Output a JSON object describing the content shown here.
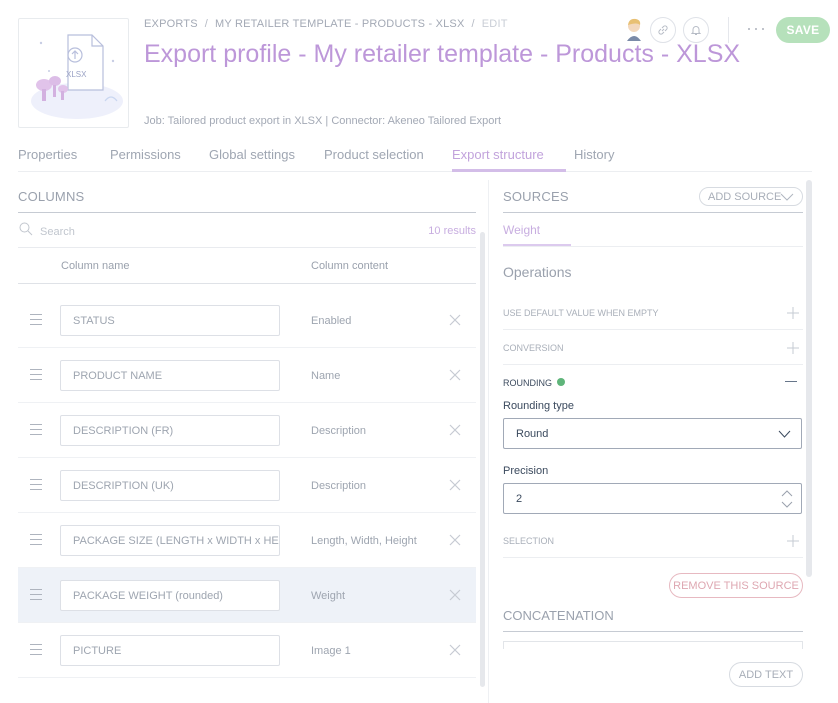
{
  "header": {
    "breadcrumb": [
      "EXPORTS",
      "MY RETAILER TEMPLATE - PRODUCTS - XLSX",
      "EDIT"
    ],
    "title": "Export profile - My retailer template - Products - XLSX",
    "job_line": "Job: Tailored product export in XLSX | Connector: Akeneo Tailored Export",
    "thumbnail_text": "XLSX",
    "save_label": "SAVE",
    "more_label": "···"
  },
  "tabs": [
    "Properties",
    "Permissions",
    "Global settings",
    "Product selection",
    "Export structure",
    "History"
  ],
  "active_tab": "Export structure",
  "columns": {
    "title": "COLUMNS",
    "search_placeholder": "Search",
    "results": "10 results",
    "header_name": "Column name",
    "header_content": "Column content",
    "rows": [
      {
        "name": "STATUS",
        "content": "Enabled"
      },
      {
        "name": "PRODUCT NAME",
        "content": "Name"
      },
      {
        "name": "DESCRIPTION (FR)",
        "content": "Description"
      },
      {
        "name": "DESCRIPTION (UK)",
        "content": "Description"
      },
      {
        "name": "PACKAGE SIZE (LENGTH x WIDTH x HEIGI",
        "content": "Length, Width, Height"
      },
      {
        "name": "PACKAGE WEIGHT (rounded)",
        "content": "Weight"
      },
      {
        "name": "PICTURE",
        "content": "Image 1"
      }
    ],
    "selected_row": "PACKAGE WEIGHT (rounded)"
  },
  "sources": {
    "title": "SOURCES",
    "add_source_label": "ADD SOURCE",
    "active_source": "Weight",
    "operations_title": "Operations",
    "operations": {
      "default_value": "USE DEFAULT VALUE WHEN EMPTY",
      "conversion": "CONVERSION",
      "rounding": "ROUNDING",
      "selection": "SELECTION"
    },
    "rounding_type_label": "Rounding type",
    "rounding_type_value": "Round",
    "precision_label": "Precision",
    "precision_value": "2",
    "remove_source_label": "REMOVE THIS SOURCE",
    "concatenation_title": "CONCATENATION",
    "add_text_label": "ADD TEXT"
  },
  "colors": {
    "accent": "#bd97d9",
    "save": "#b6e1bb",
    "status_dot": "#5fb57a",
    "danger": "#dea7b1"
  },
  "icons": [
    "export-file-illustration",
    "user-avatar-icon",
    "link-icon",
    "bell-icon",
    "search-icon",
    "drag-handle-icon",
    "close-icon",
    "chevron-down-icon",
    "plus-icon",
    "minus-icon",
    "stepper-icon"
  ]
}
